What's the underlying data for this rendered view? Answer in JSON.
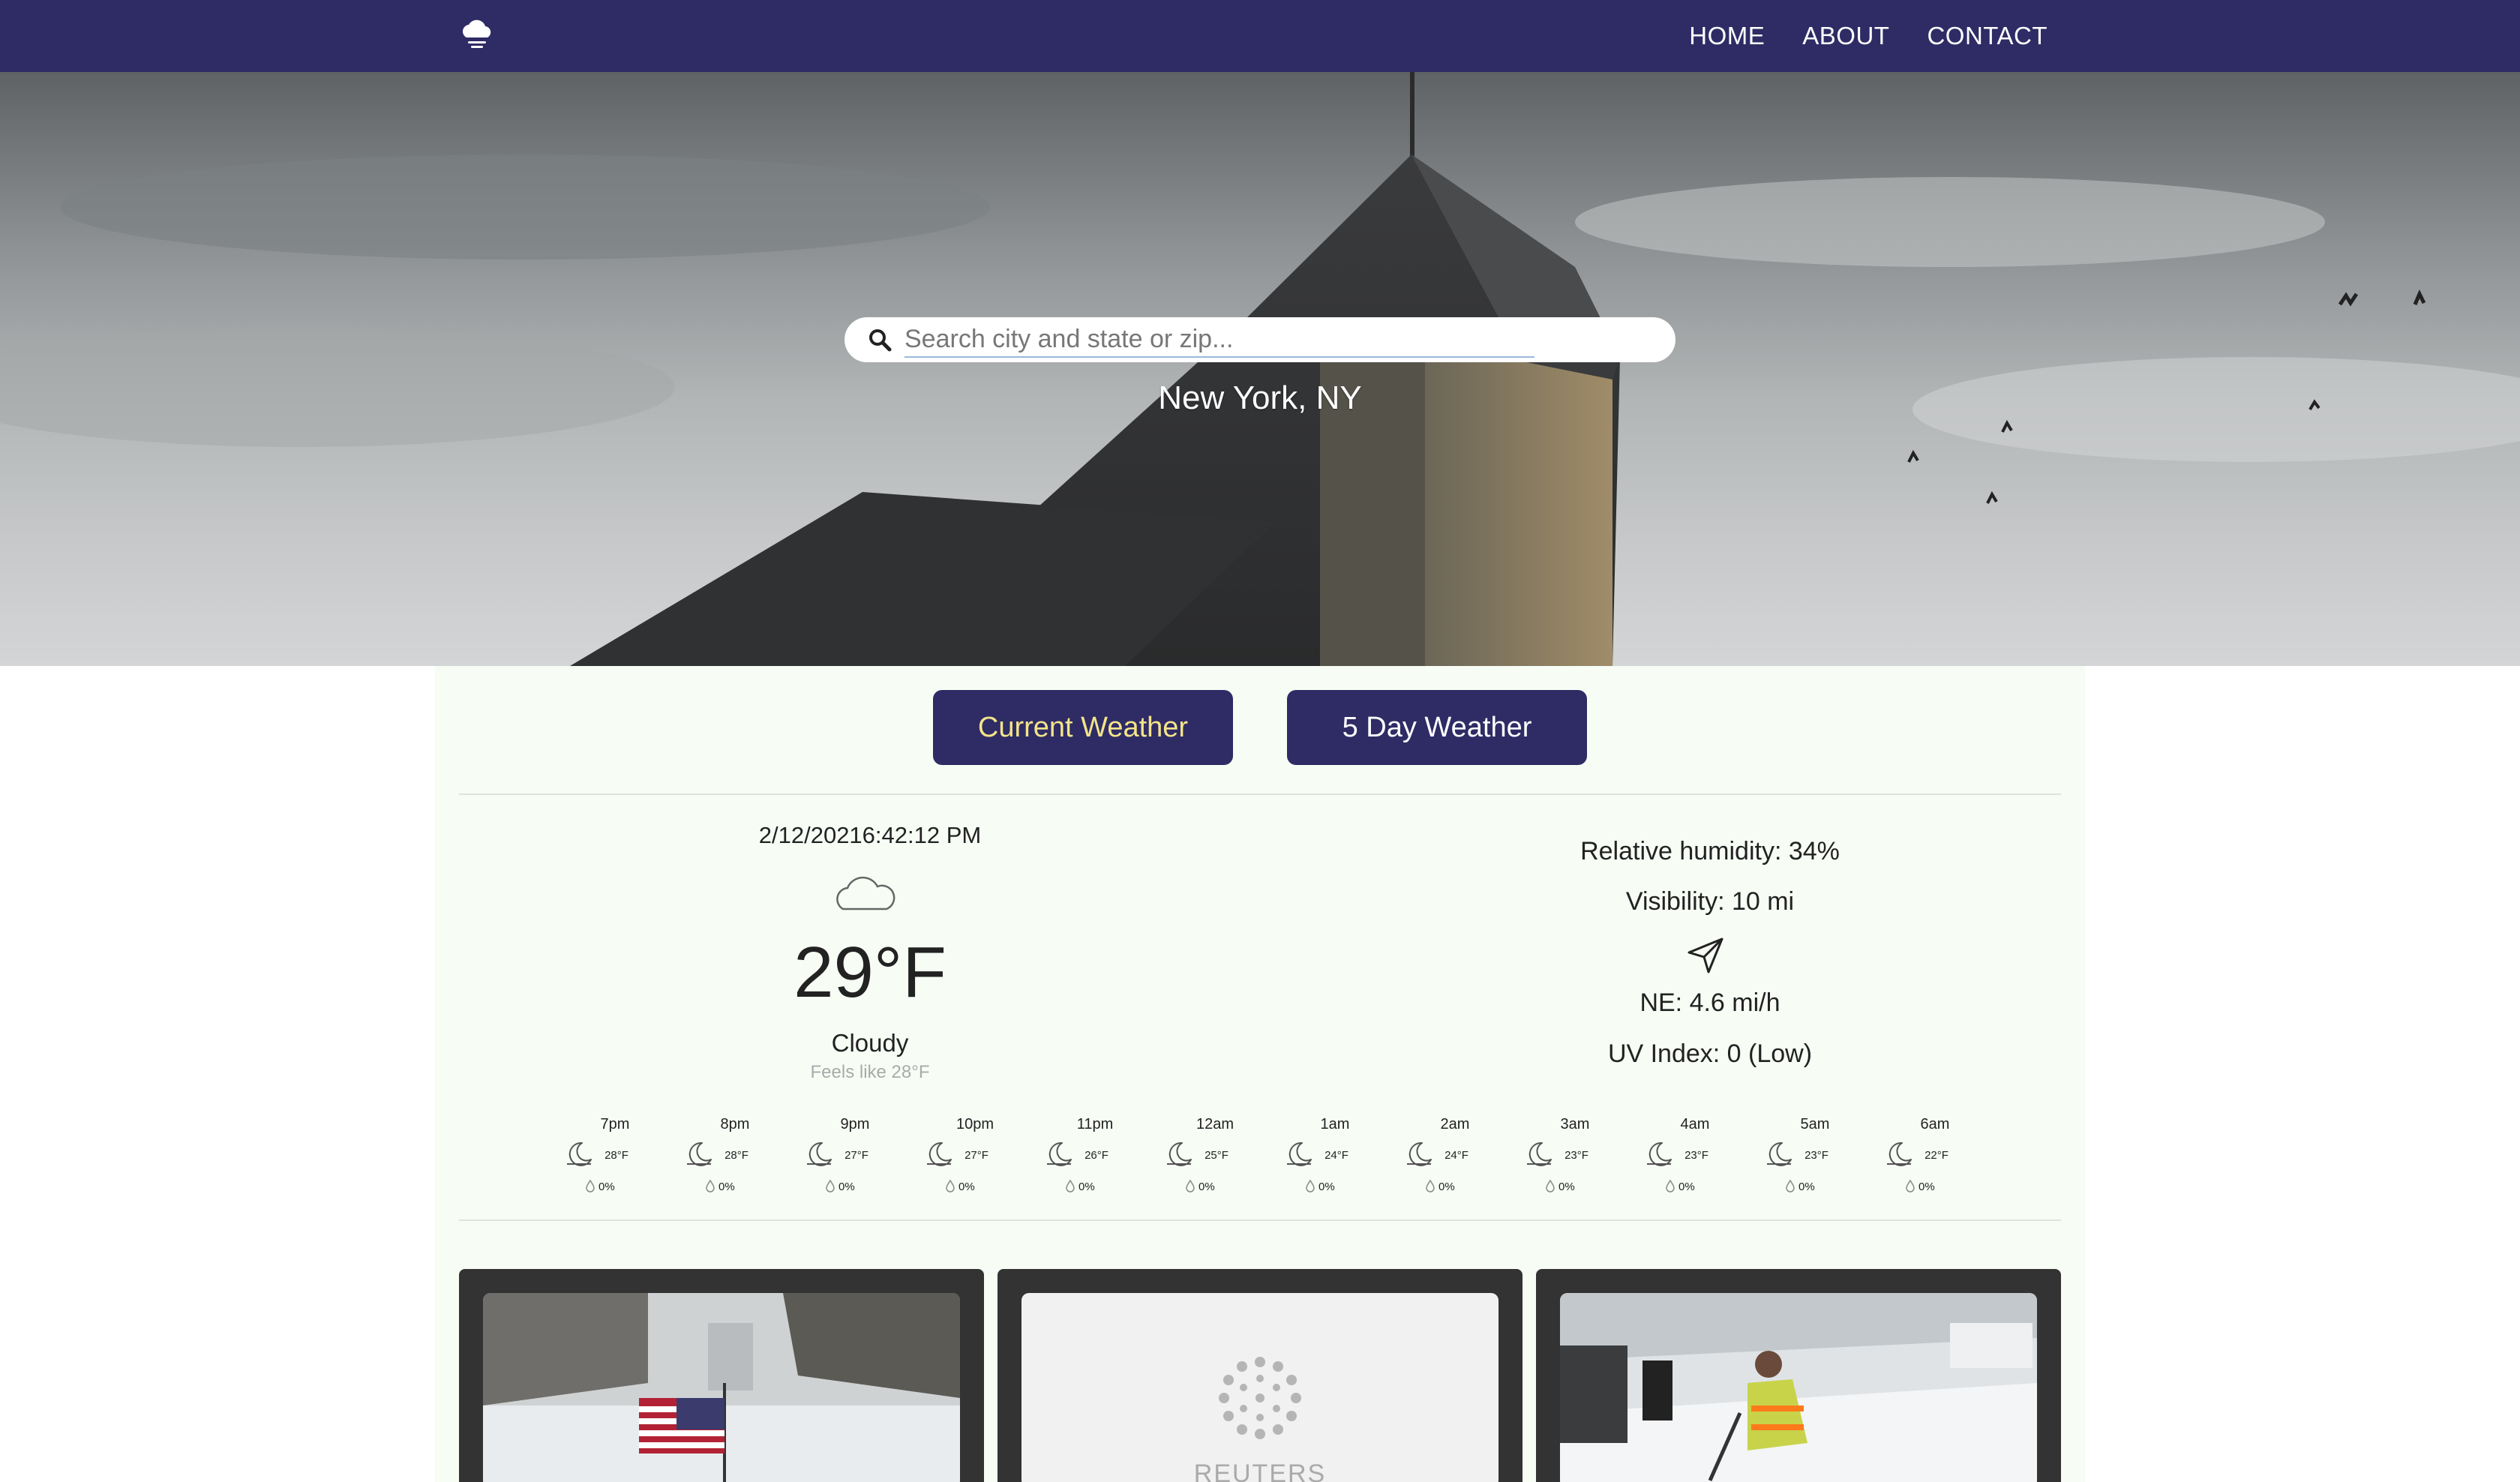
{
  "nav": {
    "logo_icon": "cloud-logo-icon",
    "links": [
      {
        "label": "HOME"
      },
      {
        "label": "ABOUT"
      },
      {
        "label": "CONTACT"
      }
    ],
    "background": "#2e2b65"
  },
  "hero": {
    "search": {
      "placeholder": "Search city and state or zip...",
      "value": "",
      "icon": "search-icon"
    },
    "location": "New York, NY"
  },
  "tabs": {
    "current_label": "Current Weather",
    "five_day_label": "5 Day Weather",
    "active_color": "#f3e48a"
  },
  "current": {
    "datetime": "2/12/20216:42:12 PM",
    "icon": "cloud-icon",
    "temperature": "29°F",
    "condition": "Cloudy",
    "feels_like": "Feels like 28°F",
    "humidity": "Relative humidity: 34%",
    "visibility": "Visibility: 10 mi",
    "wind_icon": "wind-direction-icon",
    "wind": "NE: 4.6 mi/h",
    "uv": "UV Index: 0 (Low)"
  },
  "hourly": [
    {
      "time": "7pm",
      "temp": "28°F",
      "precip": "0%",
      "icon": "moon-icon"
    },
    {
      "time": "8pm",
      "temp": "28°F",
      "precip": "0%",
      "icon": "moon-icon"
    },
    {
      "time": "9pm",
      "temp": "27°F",
      "precip": "0%",
      "icon": "moon-icon"
    },
    {
      "time": "10pm",
      "temp": "27°F",
      "precip": "0%",
      "icon": "moon-icon"
    },
    {
      "time": "11pm",
      "temp": "26°F",
      "precip": "0%",
      "icon": "moon-icon"
    },
    {
      "time": "12am",
      "temp": "25°F",
      "precip": "0%",
      "icon": "moon-icon"
    },
    {
      "time": "1am",
      "temp": "24°F",
      "precip": "0%",
      "icon": "moon-icon"
    },
    {
      "time": "2am",
      "temp": "24°F",
      "precip": "0%",
      "icon": "moon-icon"
    },
    {
      "time": "3am",
      "temp": "23°F",
      "precip": "0%",
      "icon": "moon-icon"
    },
    {
      "time": "4am",
      "temp": "23°F",
      "precip": "0%",
      "icon": "moon-icon"
    },
    {
      "time": "5am",
      "temp": "23°F",
      "precip": "0%",
      "icon": "moon-icon"
    },
    {
      "time": "6am",
      "temp": "22°F",
      "precip": "0%",
      "icon": "moon-icon"
    }
  ],
  "news": {
    "cards": [
      {
        "image": "snowy-street-flag-image"
      },
      {
        "image": "reuters-logo-image",
        "logo_text": "REUTERS"
      },
      {
        "image": "snow-shoveling-worker-image"
      }
    ]
  }
}
